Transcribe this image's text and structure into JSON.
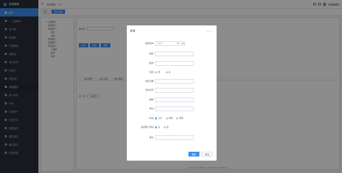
{
  "app": {
    "name": "系统管理"
  },
  "sidebar": {
    "items": [
      {
        "label": "用户",
        "active": true
      },
      {
        "label": "一二级菜单"
      },
      {
        "label": "用户管"
      },
      {
        "label": "权限管"
      },
      {
        "label": "字典管理"
      },
      {
        "label": "参数设"
      },
      {
        "label": "定时任务"
      },
      {
        "label": "系统日"
      },
      {
        "label": "系统用户"
      }
    ],
    "section": "系统监控",
    "sub_items": [
      "接口开发",
      "代码",
      "在线用户",
      "系统日志",
      "数据监控",
      "服务监控",
      "缓存监控",
      "在线构建"
    ]
  },
  "topbar": {
    "breadcrumb": [
      "系统管理",
      "用户"
    ],
    "user": "系统管理员"
  },
  "tags": [
    "首页",
    "用户管理"
  ],
  "tree": {
    "nodes": [
      {
        "label": "一二级菜单",
        "level": 1
      },
      {
        "label": "市场部门",
        "level": 2
      },
      {
        "label": "研发部门",
        "level": 2
      },
      {
        "label": "测试",
        "level": 3
      },
      {
        "label": "运维",
        "level": 3
      },
      {
        "label": "财务部门",
        "level": 2
      },
      {
        "label": "运维部门",
        "level": 2
      },
      {
        "label": "测试部门",
        "level": 2
      },
      {
        "label": "人事部",
        "level": 3
      },
      {
        "label": "运营",
        "level": 3
      },
      {
        "label": "市场",
        "level": 3
      }
    ]
  },
  "search": {
    "label1": "用户名",
    "label2": "状态",
    "status_placeholder": "请选择状态",
    "search_btn": "搜索"
  },
  "toolbar": {
    "add": "新增",
    "edit": "修改",
    "delete": "删除"
  },
  "table": {
    "headers": [
      "用户编号",
      "用户名称",
      "用户昵称",
      "部门",
      "手机号码",
      "状态",
      "创建时间",
      "操作"
    ]
  },
  "pager": {
    "total": "共 0 条",
    "size": "10条/页"
  },
  "footer": "Copyright © 2019 ~ present ElementAdmin",
  "modal": {
    "title": "新增",
    "fields": {
      "dept": {
        "label": "组织机构",
        "placeholder": "请选择"
      },
      "name": {
        "label": "姓名"
      },
      "account": {
        "label": "账号"
      },
      "gender": {
        "label": "性别",
        "options": [
          "男",
          "女"
        ]
      },
      "birthday": {
        "label": "出生日期"
      },
      "id_card": {
        "label": "身份证号"
      },
      "email": {
        "label": "邮箱"
      },
      "position": {
        "label": "职位"
      },
      "status": {
        "label": "状态",
        "options": [
          "正常",
          "停用",
          "离职"
        ]
      },
      "is_leader": {
        "label": "是否部门领导",
        "options": [
          "是",
          "否"
        ]
      },
      "remark": {
        "label": "备注"
      }
    },
    "confirm": "确定",
    "cancel": "取消"
  }
}
